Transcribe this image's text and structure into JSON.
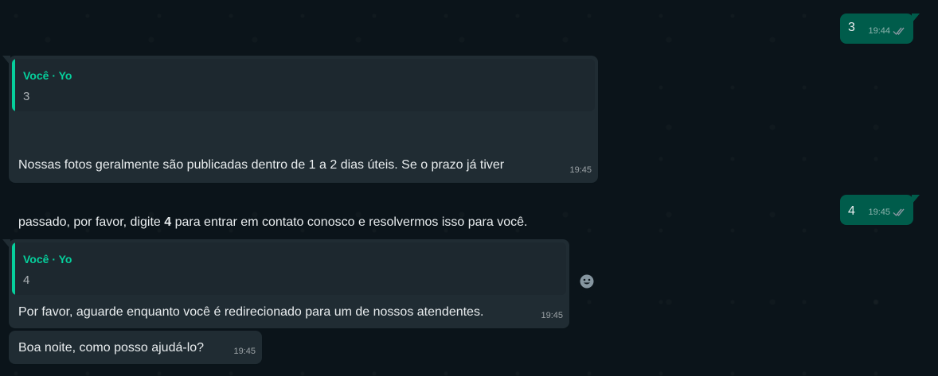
{
  "messages": {
    "m1": {
      "text": "3",
      "time": "19:44"
    },
    "m2": {
      "quote_author": "Você · Yo",
      "quote_text": "3",
      "text_line1": "Nossas fotos geralmente são publicadas dentro de 1 a 2 dias úteis. Se o prazo já tiver",
      "text_line2_pre": "passado, por favor, digite ",
      "text_line2_bold": "4",
      "text_line2_post": " para entrar em contato conosco e resolvermos isso para você.",
      "time": "19:45"
    },
    "m3": {
      "text": "4",
      "time": "19:45"
    },
    "m4": {
      "quote_author": "Você · Yo",
      "quote_text": "4",
      "text": "Por favor, aguarde enquanto você é redirecionado para um de nossos atendentes.",
      "time": "19:45"
    },
    "m5": {
      "text": "Boa noite, como posso ajudá-lo?",
      "time": "19:45"
    }
  },
  "colors": {
    "background": "#0b141a",
    "outgoing_bubble": "#005c4b",
    "incoming_bubble": "#202c33",
    "quote_accent": "#06cf9c"
  },
  "icons": {
    "read_receipt": "double-check-icon",
    "reaction": "smiley-icon"
  }
}
